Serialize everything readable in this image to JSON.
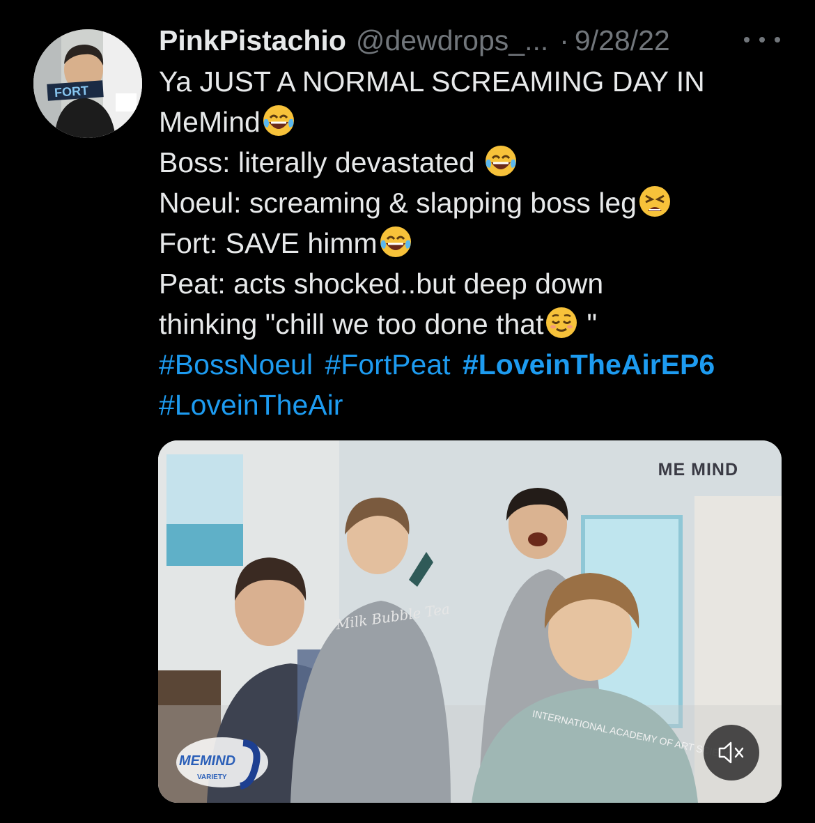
{
  "tweet": {
    "display_name": "PinkPistachio",
    "handle": "@dewdrops_...",
    "separator": "·",
    "date": "9/28/22",
    "avatar_label": "FORT",
    "lines": [
      "Ya JUST A NORMAL SCREAMING DAY IN",
      "MeMind",
      "Boss: literally devastated ",
      "Noeul: screaming & slapping boss leg",
      "Fort: SAVE himm",
      "Peat: acts shocked..but deep down",
      "thinking \"chill we too done that",
      "\""
    ],
    "hashtags": [
      "#BossNoeul",
      "#FortPeat",
      "#LoveinTheAirEP6",
      "#LoveinTheAir"
    ],
    "emojis": {
      "memind": "face-with-tears-of-joy",
      "boss": "face-with-tears-of-joy",
      "noeul": "tired-face",
      "fort": "face-with-tears-of-joy",
      "chill": "relieved-face"
    }
  },
  "media": {
    "watermark": "ME MIND",
    "logo_text": "MEMIND",
    "logo_sub": "VARIETY",
    "sweater_text_1": "Milk Bubble Tea",
    "sweater_text_2": "INTERNATIONAL ACADEMY OF ART SCIENCE",
    "mute_icon": "speaker-muted-icon"
  },
  "colors": {
    "background": "#000000",
    "text": "#e7e9ea",
    "muted": "#71767b",
    "link": "#1d9bf0"
  }
}
